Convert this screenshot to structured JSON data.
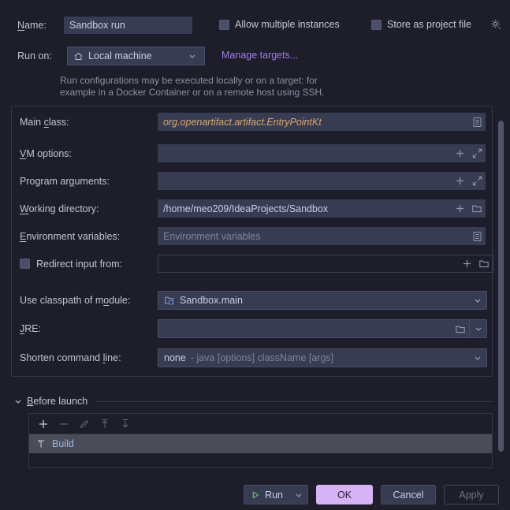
{
  "dialog": {
    "accent_color": "#d6b3f7",
    "link_color": "#a07ce8",
    "background": "#1d1e29",
    "field_background": "#383c52"
  },
  "header": {
    "name_label": "Name:",
    "name_mnemonic": "N",
    "name_value": "Sandbox run",
    "allow_multiple_instances_label": "Allow multiple instances",
    "allow_multiple_instances_checked": false,
    "store_as_project_file_label": "Store as project file",
    "store_as_project_file_checked": false,
    "gear_icon": "gear-icon",
    "run_on_label": "Run on:",
    "run_on_value": "Local machine",
    "run_on_icon": "home-icon",
    "manage_targets_label": "Manage targets...",
    "hint_line1": "Run configurations may be executed locally or on a target: for",
    "hint_line2": "example in a Docker Container or on a remote host using SSH."
  },
  "fields": {
    "main_class": {
      "label": "Main class:",
      "mnemonic": "c",
      "value": "org.openartifact.artifact.EntryPointKt",
      "icons": [
        "list-document-icon"
      ]
    },
    "vm_options": {
      "label": "VM options:",
      "mnemonic": "V",
      "value": "",
      "icons": [
        "plus-icon",
        "expand-icon"
      ]
    },
    "program_arguments": {
      "label": "Program arguments:",
      "mnemonic": "g",
      "value": "",
      "icons": [
        "plus-icon",
        "expand-icon"
      ]
    },
    "working_directory": {
      "label": "Working directory:",
      "mnemonic": "W",
      "value": "/home/meo209/IdeaProjects/Sandbox",
      "icons": [
        "plus-icon",
        "folder-icon"
      ]
    },
    "environment_variables": {
      "label": "Environment variables:",
      "mnemonic": "E",
      "value": "",
      "placeholder": "Environment variables",
      "icons": [
        "list-document-icon"
      ]
    },
    "redirect_input": {
      "label": "Redirect input from:",
      "checked": false,
      "value": "",
      "icons": [
        "plus-icon",
        "folder-icon"
      ]
    },
    "use_classpath_of_module": {
      "label": "Use classpath of module:",
      "mnemonic": "o",
      "value": "Sandbox.main",
      "icon": "module-icon"
    },
    "jre": {
      "label": "JRE:",
      "mnemonic": "J",
      "value": "",
      "icons": [
        "folder-icon",
        "chevron-down-icon"
      ]
    },
    "shorten_command_line": {
      "label": "Shorten command line:",
      "mnemonic": "l",
      "value": "none",
      "value_suffix": "- java [options] className [args]"
    }
  },
  "before_launch": {
    "title": "Before launch",
    "mnemonic": "B",
    "expanded": true,
    "toolbar": [
      {
        "name": "add-button",
        "glyph": "+",
        "enabled": true
      },
      {
        "name": "remove-button",
        "glyph": "−",
        "enabled": false
      },
      {
        "name": "edit-button",
        "glyph": "pencil-icon",
        "enabled": false
      },
      {
        "name": "move-up-button",
        "glyph": "arrow-up-icon",
        "enabled": false
      },
      {
        "name": "move-down-button",
        "glyph": "arrow-down-icon",
        "enabled": false
      }
    ],
    "items": [
      {
        "label": "Build",
        "icon": "hammer-icon",
        "selected": true
      }
    ]
  },
  "buttons": {
    "run_label": "Run",
    "run_icon": "play-icon",
    "ok_label": "OK",
    "cancel_label": "Cancel",
    "apply_label": "Apply",
    "apply_enabled": false
  }
}
